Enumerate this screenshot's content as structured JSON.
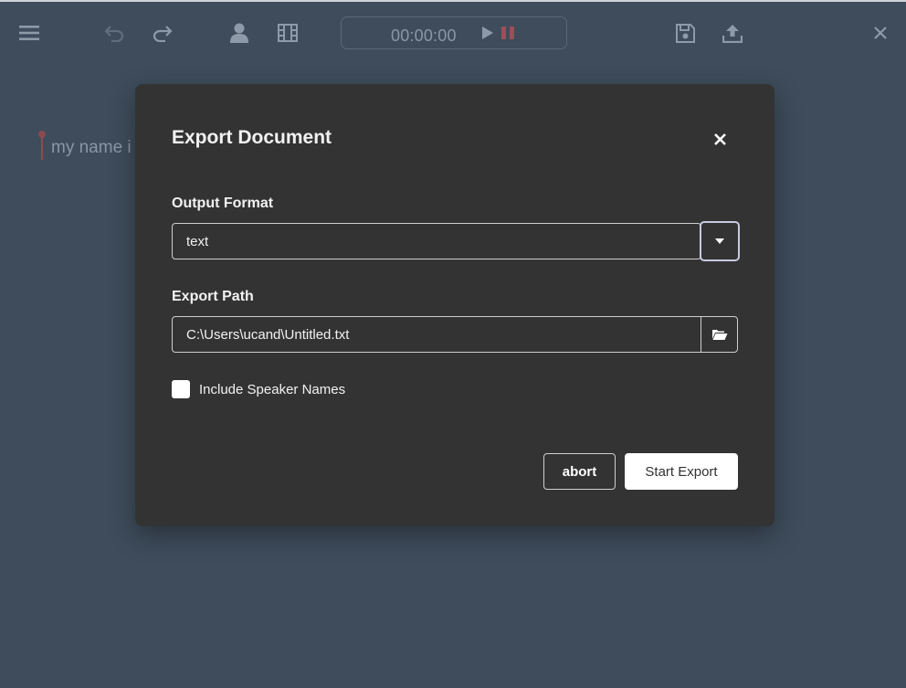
{
  "toolbar": {
    "icons": [
      "menu-icon",
      "undo-icon",
      "redo-icon",
      "speaker-icon",
      "film-icon",
      "play-icon",
      "pause-icon",
      "save-icon",
      "upload-icon",
      "close-icon"
    ],
    "time": "00:00:00"
  },
  "editor": {
    "text": "my name i"
  },
  "dialog": {
    "title": "Export Document",
    "output_format": {
      "label": "Output Format",
      "value": "text"
    },
    "export_path": {
      "label": "Export Path",
      "value": "C:\\Users\\ucand\\Untitled.txt"
    },
    "include_speaker_names": {
      "label": "Include Speaker Names",
      "checked": false
    },
    "abort_label": "abort",
    "start_label": "Start Export"
  },
  "colors": {
    "background": "#3e4c5b",
    "dialog": "#333333",
    "icon": "#8e9aa7",
    "pause": "#9b4f58",
    "pin": "#8a4a52"
  }
}
